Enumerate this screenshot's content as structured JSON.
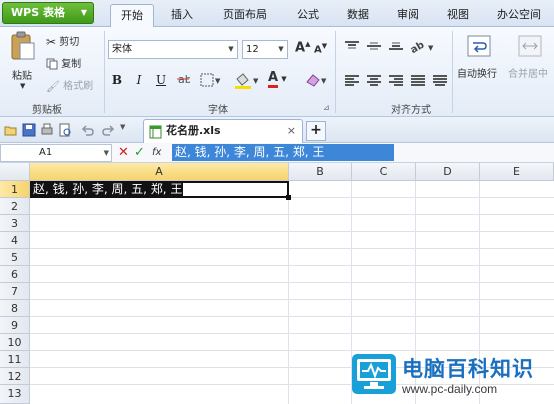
{
  "menubar": {
    "app_button": "WPS 表格",
    "tabs": [
      "开始",
      "插入",
      "页面布局",
      "公式",
      "数据",
      "审阅",
      "视图",
      "办公空间"
    ],
    "active_tab": "开始"
  },
  "ribbon": {
    "clipboard": {
      "paste": "粘贴",
      "cut": "剪切",
      "copy": "复制",
      "format_painter": "格式刷",
      "group_label": "剪贴板"
    },
    "font": {
      "font_name": "宋体",
      "font_size": "12",
      "bold": "B",
      "italic": "I",
      "underline": "U",
      "font_color_letter": "A",
      "grow": "A",
      "shrink": "A",
      "group_label": "字体"
    },
    "alignment": {
      "group_label": "对齐方式",
      "wrap_text": "自动换行",
      "merge_center": "合并居中"
    }
  },
  "docbar": {
    "file_tab": "花名册.xls",
    "close": "×",
    "new_tab": "+"
  },
  "formula": {
    "name_box": "A1",
    "cancel": "✕",
    "confirm": "✓",
    "fx": "fx",
    "content": "赵, 钱, 孙, 李, 周, 五, 郑, 王"
  },
  "sheet": {
    "columns": [
      "A",
      "B",
      "C",
      "D",
      "E"
    ],
    "rows": [
      "1",
      "2",
      "3",
      "4",
      "5",
      "6",
      "7",
      "8",
      "9",
      "10",
      "11",
      "12",
      "13"
    ],
    "cell_a1": "赵, 钱, 孙, 李, 周, 五, 郑, 王"
  },
  "watermark": {
    "title": "电脑百科知识",
    "url": "www.pc-daily.com"
  },
  "colors": {
    "accent_green": "#3f9a1a",
    "selection_blue": "#3d86d8",
    "header_highlight": "#f6d46b"
  }
}
